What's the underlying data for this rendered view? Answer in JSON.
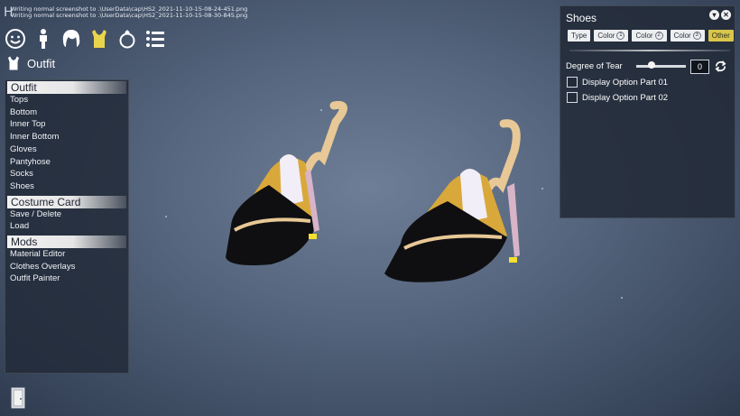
{
  "log": {
    "line1": "Writing normal screenshot to .\\UserData\\cap\\HS2_2021-11-10-15-08-24-451.png",
    "line2": "Writing normal screenshot to .\\UserData\\cap\\HS2_2021-11-10-15-08-30-845.png"
  },
  "corner_letter": "H",
  "category_icons": [
    "face-icon",
    "body-icon",
    "hair-icon",
    "outfit-icon",
    "accessory-icon",
    "list-icon"
  ],
  "section": {
    "title": "Outfit"
  },
  "menu": {
    "groups": [
      {
        "title": "Outfit",
        "items": [
          "Tops",
          "Bottom",
          "Inner Top",
          "Inner Bottom",
          "Gloves",
          "Pantyhose",
          "Socks",
          "Shoes"
        ]
      },
      {
        "title": "Costume Card",
        "items": [
          "Save / Delete",
          "Load"
        ]
      },
      {
        "title": "Mods",
        "items": [
          "Material Editor",
          "Clothes Overlays",
          "Outfit Painter"
        ]
      }
    ]
  },
  "shoes_panel": {
    "title": "Shoes",
    "tabs": [
      {
        "label": "Type",
        "num": ""
      },
      {
        "label": "Color",
        "num": "1"
      },
      {
        "label": "Color",
        "num": "2"
      },
      {
        "label": "Color",
        "num": "3"
      },
      {
        "label": "Other",
        "num": ""
      }
    ],
    "active_tab": "Other",
    "degree_of_tear": {
      "label": "Degree of Tear",
      "value": "0",
      "fraction": 0.3
    },
    "options": [
      "Display Option Part 01",
      "Display Option Part 02"
    ]
  },
  "colors": {
    "accent": "#d9c64a",
    "panel": "#222a38",
    "background": "#56667e"
  }
}
